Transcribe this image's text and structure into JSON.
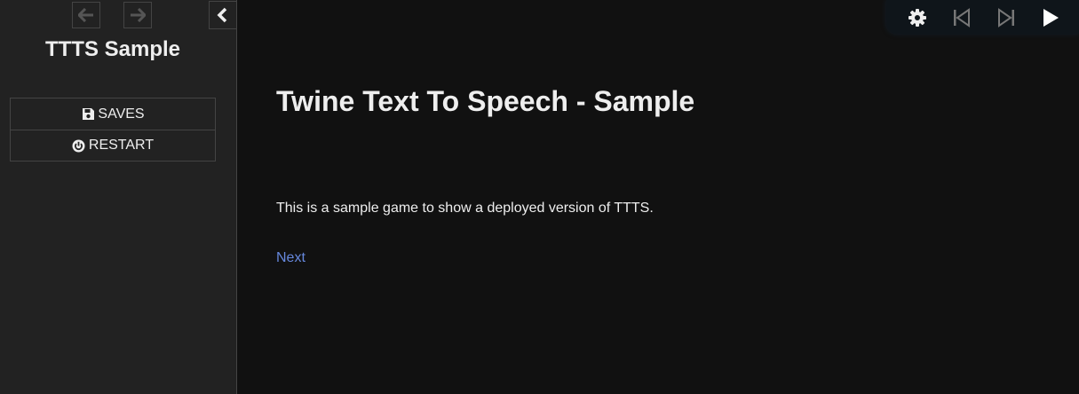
{
  "sidebar": {
    "story_title": "TTTS Sample",
    "history_back_icon": "arrow-left-icon",
    "history_forward_icon": "arrow-right-icon",
    "toggle_icon": "chevron-left-icon",
    "menu": [
      {
        "label": "SAVES",
        "icon": "floppy-disk-icon"
      },
      {
        "label": "RESTART",
        "icon": "power-icon"
      }
    ]
  },
  "tts_controls": {
    "icons": [
      "gear-icon",
      "skip-previous-icon",
      "skip-next-icon",
      "play-icon"
    ]
  },
  "passage": {
    "title": "Twine Text To Speech - Sample",
    "text": "This is a sample game to show a deployed version of TTTS.",
    "link": "Next"
  },
  "colors": {
    "background": "#111111",
    "sidebar": "#222222",
    "border": "#444444",
    "text": "#eeeeee",
    "link": "#6688dd",
    "disabled": "#555555"
  }
}
